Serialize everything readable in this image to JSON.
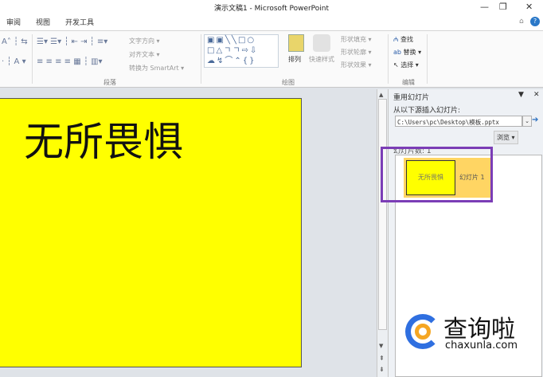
{
  "window": {
    "title": "演示文稿1 - Microsoft PowerPoint",
    "minimize": "—",
    "restore": "❐",
    "close": "✕",
    "help": "?",
    "collapse": "⌂"
  },
  "tabs": [
    "审阅",
    "视图",
    "开发工具"
  ],
  "ribbon": {
    "paragraph": {
      "label": "段落",
      "text_direction": "文字方向 ▾",
      "align_text": "对齐文本 ▾",
      "smartart": "转换为 SmartArt ▾"
    },
    "drawing": {
      "label": "绘图",
      "arrange": "排列",
      "quick_styles": "快速样式",
      "shape_fill": "形状填充 ▾",
      "shape_outline": "形状轮廓 ▾",
      "shape_effects": "形状效果 ▾"
    },
    "editing": {
      "label": "编辑",
      "find": "查找",
      "replace": "替换 ▾",
      "select": "选择 ▾"
    }
  },
  "slide": {
    "text": "无所畏惧"
  },
  "panel": {
    "title": "重用幻灯片",
    "insert_from_label": "从以下源插入幻灯片:",
    "path": "C:\\Users\\pc\\Desktop\\模板.pptx",
    "browse": "浏览 ▾",
    "slides_label": "幻灯片数: 1",
    "items": [
      {
        "thumb_text": "无所畏惧",
        "name": "幻灯片 1"
      }
    ]
  },
  "watermark": {
    "brand": "查询啦",
    "url": "chaxunla.com"
  }
}
